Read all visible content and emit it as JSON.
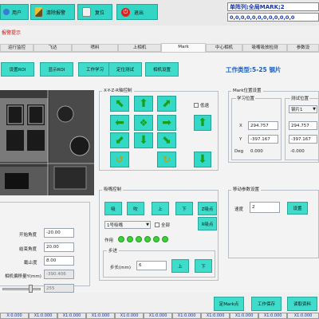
{
  "toolbar": {
    "user_label": "用户",
    "clear_alarm_label": "清除报警",
    "reset_label": "复位",
    "exit_label": "退出"
  },
  "header": {
    "status_line1": "单阵列;全局MARK;2",
    "status_line2": "0,0,0,0,0,0,0,0,0,0,0,0",
    "alarm_text": "报警提示"
  },
  "tabs": [
    "运行监控",
    "飞达",
    "喷料",
    "上相机",
    "Mark",
    "中心相机",
    "吸嘴吸放检测",
    "参数设"
  ],
  "active_tab": "Mark",
  "action_buttons": [
    "设置ROI",
    "显示ROI",
    "工作学习",
    "定位测试",
    "相机设置"
  ],
  "work_type": "工作类型:5-25  钢片",
  "xyz_control": {
    "title": "X-Y-Z-R轴控制",
    "low_speed_label": "低速",
    "arrows": [
      "arrow-up-left",
      "arrow-up",
      "arrow-up-right",
      "arrow-left",
      "arrow-right",
      "arrow-up",
      "arrow-down-left",
      "arrow-down",
      "arrow-down-right",
      "rotate-ccw",
      "rotate-cw",
      "arrow-down"
    ]
  },
  "mark_position": {
    "title": "Mark位置设置",
    "learn_title": "学习位置",
    "test_title": "测试位置",
    "test_select": "钢片1",
    "x_label": "X",
    "y_label": "Y",
    "deg_label": "Deg",
    "learn_x": "294.757",
    "learn_y": "-397.167",
    "learn_deg": "0.000",
    "test_x": "294.757",
    "test_y": "-397.167",
    "test_deg": "-0.000"
  },
  "suction_control": {
    "title": "吸嘴控制",
    "buttons": [
      "吸",
      "吹",
      "上",
      "下",
      "Z吸点"
    ],
    "nozzle_select": "1号吸嘴",
    "all_label": "全部",
    "r_point_label": "R吸点",
    "action_label": "作用",
    "led_count": 6,
    "step_title": "步进",
    "step_label": "步长(mm)",
    "step_value": "6",
    "step_up": "上",
    "step_down": "下"
  },
  "left_params": {
    "start_angle_label": "开始角度",
    "start_angle_value": "-20.00",
    "end_angle_label": "结束角度",
    "end_angle_value": "20.00",
    "cutoff_label": "截止度",
    "cutoff_value": "8.00",
    "offset_label": "相机偏移量Y(mm)",
    "offset_value": "-390.406",
    "slider_value": "255"
  },
  "speed_group": {
    "title": "移动参数设置",
    "speed_label": "速度",
    "speed_value": "2",
    "set_label": "设置"
  },
  "bottom_buttons": [
    "定Mark点",
    "工作保存",
    "读取资料"
  ],
  "status_bar": [
    "X:0.000",
    "X1:0.000",
    "X1:0.000",
    "X1:0.000",
    "X1:0.000",
    "X1:0.000",
    "X1:0.000",
    "X1:0.000",
    "X1:0.000",
    "X1:0.000",
    "X1:0.000"
  ]
}
